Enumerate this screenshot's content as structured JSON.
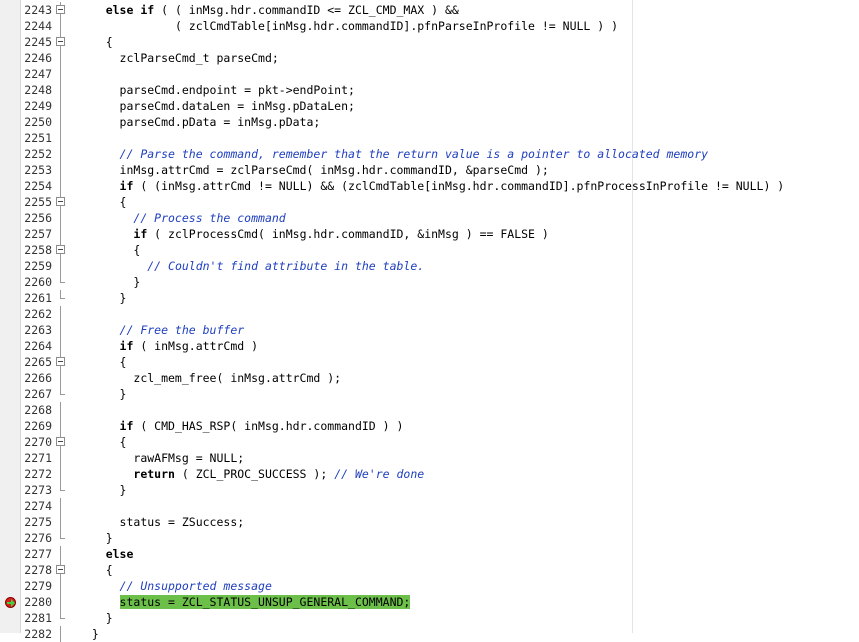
{
  "editor": {
    "current_line": "2280",
    "lines": [
      {
        "num": "2243",
        "fold": "box",
        "indent": "    ",
        "parts": [
          {
            "t": "else if",
            "c": "kw"
          },
          {
            "t": " ( ( inMsg.hdr.commandID <= ZCL_CMD_MAX ) &&"
          }
        ]
      },
      {
        "num": "2244",
        "fold": "line",
        "indent": "              ",
        "parts": [
          {
            "t": "( zclCmdTable[inMsg.hdr.commandID].pfnParseInProfile != NULL ) )"
          }
        ]
      },
      {
        "num": "2245",
        "fold": "box",
        "indent": "    ",
        "parts": [
          {
            "t": "{"
          }
        ]
      },
      {
        "num": "2246",
        "fold": "line",
        "indent": "      ",
        "parts": [
          {
            "t": "zclParseCmd_t parseCmd;"
          }
        ]
      },
      {
        "num": "2247",
        "fold": "line",
        "indent": "",
        "parts": []
      },
      {
        "num": "2248",
        "fold": "line",
        "indent": "      ",
        "parts": [
          {
            "t": "parseCmd.endpoint = pkt->endPoint;"
          }
        ]
      },
      {
        "num": "2249",
        "fold": "line",
        "indent": "      ",
        "parts": [
          {
            "t": "parseCmd.dataLen = inMsg.pDataLen;"
          }
        ]
      },
      {
        "num": "2250",
        "fold": "line",
        "indent": "      ",
        "parts": [
          {
            "t": "parseCmd.pData = inMsg.pData;"
          }
        ]
      },
      {
        "num": "2251",
        "fold": "line",
        "indent": "",
        "parts": []
      },
      {
        "num": "2252",
        "fold": "line",
        "indent": "      ",
        "parts": [
          {
            "t": "// Parse the command, remember that the return value is a pointer to allocated memory",
            "c": "cm"
          }
        ]
      },
      {
        "num": "2253",
        "fold": "line",
        "indent": "      ",
        "parts": [
          {
            "t": "inMsg.attrCmd = zclParseCmd( inMsg.hdr.commandID, &parseCmd );"
          }
        ]
      },
      {
        "num": "2254",
        "fold": "line",
        "indent": "      ",
        "parts": [
          {
            "t": "if",
            "c": "kw"
          },
          {
            "t": " ( (inMsg.attrCmd != NULL) && (zclCmdTable[inMsg.hdr.commandID].pfnProcessInProfile != NULL) )"
          }
        ]
      },
      {
        "num": "2255",
        "fold": "box",
        "indent": "      ",
        "parts": [
          {
            "t": "{"
          }
        ]
      },
      {
        "num": "2256",
        "fold": "line",
        "indent": "        ",
        "parts": [
          {
            "t": "// Process the command",
            "c": "cm"
          }
        ]
      },
      {
        "num": "2257",
        "fold": "line",
        "indent": "        ",
        "parts": [
          {
            "t": "if",
            "c": "kw"
          },
          {
            "t": " ( zclProcessCmd( inMsg.hdr.commandID, &inMsg ) == FALSE )"
          }
        ]
      },
      {
        "num": "2258",
        "fold": "box",
        "indent": "        ",
        "parts": [
          {
            "t": "{"
          }
        ]
      },
      {
        "num": "2259",
        "fold": "line",
        "indent": "          ",
        "parts": [
          {
            "t": "// Couldn't find attribute in the table.",
            "c": "cm"
          }
        ]
      },
      {
        "num": "2260",
        "fold": "end",
        "indent": "        ",
        "parts": [
          {
            "t": "}"
          }
        ]
      },
      {
        "num": "2261",
        "fold": "end",
        "indent": "      ",
        "parts": [
          {
            "t": "}"
          }
        ]
      },
      {
        "num": "2262",
        "fold": "line",
        "indent": "",
        "parts": []
      },
      {
        "num": "2263",
        "fold": "line",
        "indent": "      ",
        "parts": [
          {
            "t": "// Free the buffer",
            "c": "cm"
          }
        ]
      },
      {
        "num": "2264",
        "fold": "line",
        "indent": "      ",
        "parts": [
          {
            "t": "if",
            "c": "kw"
          },
          {
            "t": " ( inMsg.attrCmd )"
          }
        ]
      },
      {
        "num": "2265",
        "fold": "box",
        "indent": "      ",
        "parts": [
          {
            "t": "{"
          }
        ]
      },
      {
        "num": "2266",
        "fold": "line",
        "indent": "        ",
        "parts": [
          {
            "t": "zcl_mem_free( inMsg.attrCmd );"
          }
        ]
      },
      {
        "num": "2267",
        "fold": "end",
        "indent": "      ",
        "parts": [
          {
            "t": "}"
          }
        ]
      },
      {
        "num": "2268",
        "fold": "line",
        "indent": "",
        "parts": []
      },
      {
        "num": "2269",
        "fold": "line",
        "indent": "      ",
        "parts": [
          {
            "t": "if",
            "c": "kw"
          },
          {
            "t": " ( CMD_HAS_RSP( inMsg.hdr.commandID ) )"
          }
        ]
      },
      {
        "num": "2270",
        "fold": "box",
        "indent": "      ",
        "parts": [
          {
            "t": "{"
          }
        ]
      },
      {
        "num": "2271",
        "fold": "line",
        "indent": "        ",
        "parts": [
          {
            "t": "rawAFMsg = NULL;"
          }
        ]
      },
      {
        "num": "2272",
        "fold": "line",
        "indent": "        ",
        "parts": [
          {
            "t": "return",
            "c": "kw"
          },
          {
            "t": " ( ZCL_PROC_SUCCESS ); "
          },
          {
            "t": "// We're done",
            "c": "cm"
          }
        ]
      },
      {
        "num": "2273",
        "fold": "end",
        "indent": "      ",
        "parts": [
          {
            "t": "}"
          }
        ]
      },
      {
        "num": "2274",
        "fold": "line",
        "indent": "",
        "parts": []
      },
      {
        "num": "2275",
        "fold": "line",
        "indent": "      ",
        "parts": [
          {
            "t": "status = ZSuccess;"
          }
        ]
      },
      {
        "num": "2276",
        "fold": "end",
        "indent": "    ",
        "parts": [
          {
            "t": "}"
          }
        ]
      },
      {
        "num": "2277",
        "fold": "line",
        "indent": "    ",
        "parts": [
          {
            "t": "else",
            "c": "kw"
          }
        ]
      },
      {
        "num": "2278",
        "fold": "box",
        "indent": "    ",
        "parts": [
          {
            "t": "{"
          }
        ]
      },
      {
        "num": "2279",
        "fold": "line",
        "indent": "      ",
        "parts": [
          {
            "t": "// Unsupported message",
            "c": "cm"
          }
        ]
      },
      {
        "num": "2280",
        "fold": "line",
        "indent": "      ",
        "hl": true,
        "parts": [
          {
            "t": "status = ZCL_STATUS_UNSUP_GENERAL_COMMAND;",
            "c": "hl"
          }
        ]
      },
      {
        "num": "2281",
        "fold": "end",
        "indent": "    ",
        "parts": [
          {
            "t": "}"
          }
        ]
      },
      {
        "num": "2282",
        "fold": "line",
        "indent": "  ",
        "parts": [
          {
            "t": "}"
          }
        ]
      }
    ]
  },
  "colors": {
    "comment": "#1f3fbf",
    "highlight": "#6cc04a",
    "breakpoint": "#d81f1f",
    "arrow": "#3fd23f"
  },
  "icons": {
    "breakpoint": "breakpoint-icon",
    "execution_arrow": "current-statement-arrow-icon",
    "fold": "fold-toggle-icon"
  }
}
